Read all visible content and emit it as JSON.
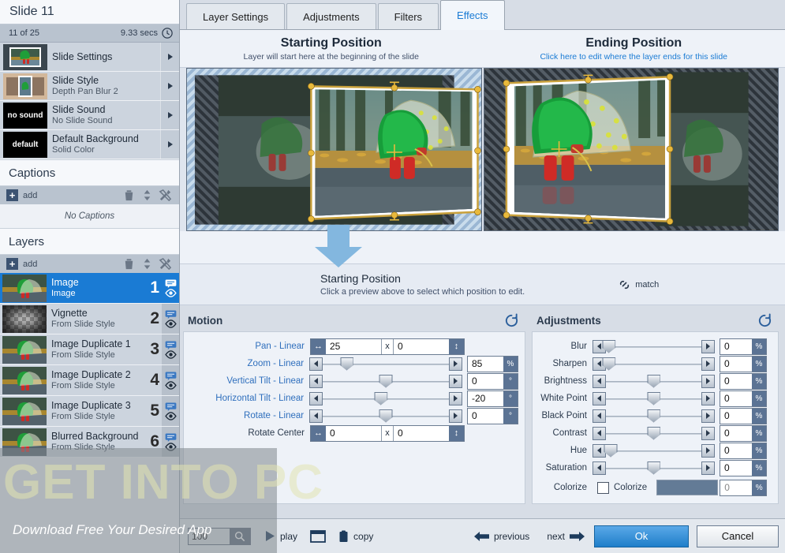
{
  "sidebar": {
    "slide_title": "Slide 11",
    "slide_index": "11 of 25",
    "slide_duration": "9.33 secs",
    "properties": [
      {
        "name": "Slide Settings",
        "sub": "",
        "thumb": "photo"
      },
      {
        "name": "Slide Style",
        "sub": "Depth Pan Blur 2",
        "thumb": "style"
      },
      {
        "name": "Slide Sound",
        "sub": "No Slide Sound",
        "thumb": "no sound"
      },
      {
        "name": "Default Background",
        "sub": "Solid Color",
        "thumb": "default"
      }
    ],
    "captions": {
      "heading": "Captions",
      "add_label": "add",
      "empty_text": "No Captions"
    },
    "layers": {
      "heading": "Layers",
      "add_label": "add",
      "items": [
        {
          "name": "Image",
          "sub": "Image",
          "num": "1",
          "selected": true
        },
        {
          "name": "Vignette",
          "sub": "From Slide Style",
          "num": "2",
          "selected": false
        },
        {
          "name": "Image Duplicate 1",
          "sub": "From Slide Style",
          "num": "3",
          "selected": false
        },
        {
          "name": "Image Duplicate 2",
          "sub": "From Slide Style",
          "num": "4",
          "selected": false
        },
        {
          "name": "Image Duplicate 3",
          "sub": "From Slide Style",
          "num": "5",
          "selected": false
        },
        {
          "name": "Blurred Background",
          "sub": "From Slide Style",
          "num": "6",
          "selected": false
        }
      ]
    }
  },
  "tabs": [
    {
      "label": "Layer Settings",
      "active": false
    },
    {
      "label": "Adjustments",
      "active": false
    },
    {
      "label": "Filters",
      "active": false
    },
    {
      "label": "Effects",
      "active": true
    }
  ],
  "positions": {
    "start": {
      "title": "Starting Position",
      "sub": "Layer will start here at the beginning of the slide"
    },
    "end": {
      "title": "Ending Position",
      "sub": "Click here to edit where the layer ends for this slide"
    }
  },
  "edit_bar": {
    "title": "Starting Position",
    "sub": "Click a preview above to select which position to edit.",
    "match_label": "match"
  },
  "motion": {
    "title": "Motion",
    "reset_icon": "reset-icon",
    "pan": {
      "label": "Pan - Linear",
      "x": "25",
      "y": "0",
      "sep": "x"
    },
    "sliders": [
      {
        "label": "Zoom - Linear",
        "value": "85",
        "unit": "%",
        "pct": 19
      },
      {
        "label": "Vertical Tilt - Linear",
        "value": "0",
        "unit": "°",
        "pct": 50
      },
      {
        "label": "Horizontal Tilt - Linear",
        "value": "-20",
        "unit": "°",
        "pct": 46
      },
      {
        "label": "Rotate - Linear",
        "value": "0",
        "unit": "°",
        "pct": 50
      }
    ],
    "rotate_center": {
      "label": "Rotate Center",
      "x": "0",
      "y": "0",
      "sep": "x"
    }
  },
  "adjustments": {
    "title": "Adjustments",
    "reset_icon": "reset-icon",
    "sliders": [
      {
        "label": "Blur",
        "value": "0",
        "unit": "%",
        "pct": 3
      },
      {
        "label": "Sharpen",
        "value": "0",
        "unit": "%",
        "pct": 3
      },
      {
        "label": "Brightness",
        "value": "0",
        "unit": "%",
        "pct": 50
      },
      {
        "label": "White Point",
        "value": "0",
        "unit": "%",
        "pct": 50
      },
      {
        "label": "Black Point",
        "value": "0",
        "unit": "%",
        "pct": 50
      },
      {
        "label": "Contrast",
        "value": "0",
        "unit": "%",
        "pct": 50
      },
      {
        "label": "Hue",
        "value": "0",
        "unit": "%",
        "pct": 5
      },
      {
        "label": "Saturation",
        "value": "0",
        "unit": "%",
        "pct": 50
      }
    ],
    "colorize": {
      "label": "Colorize",
      "checkbox_label": "Colorize",
      "swatch_color": "#637b96",
      "value": "0",
      "unit": "%"
    }
  },
  "bottom_bar": {
    "zoom_value": "100",
    "play_label": "play",
    "copy_label": "copy",
    "previous_label": "previous",
    "next_label": "next",
    "ok_label": "Ok",
    "cancel_label": "Cancel"
  },
  "watermark": {
    "brand": "GET INTO PC",
    "tagline": "Download Free Your Desired App"
  },
  "colors": {
    "accent_blue": "#1a7bd4",
    "selected_row": "#1a7bd4",
    "panel_bg": "#eef2f8",
    "sidebar_bg": "#e9edf3"
  }
}
